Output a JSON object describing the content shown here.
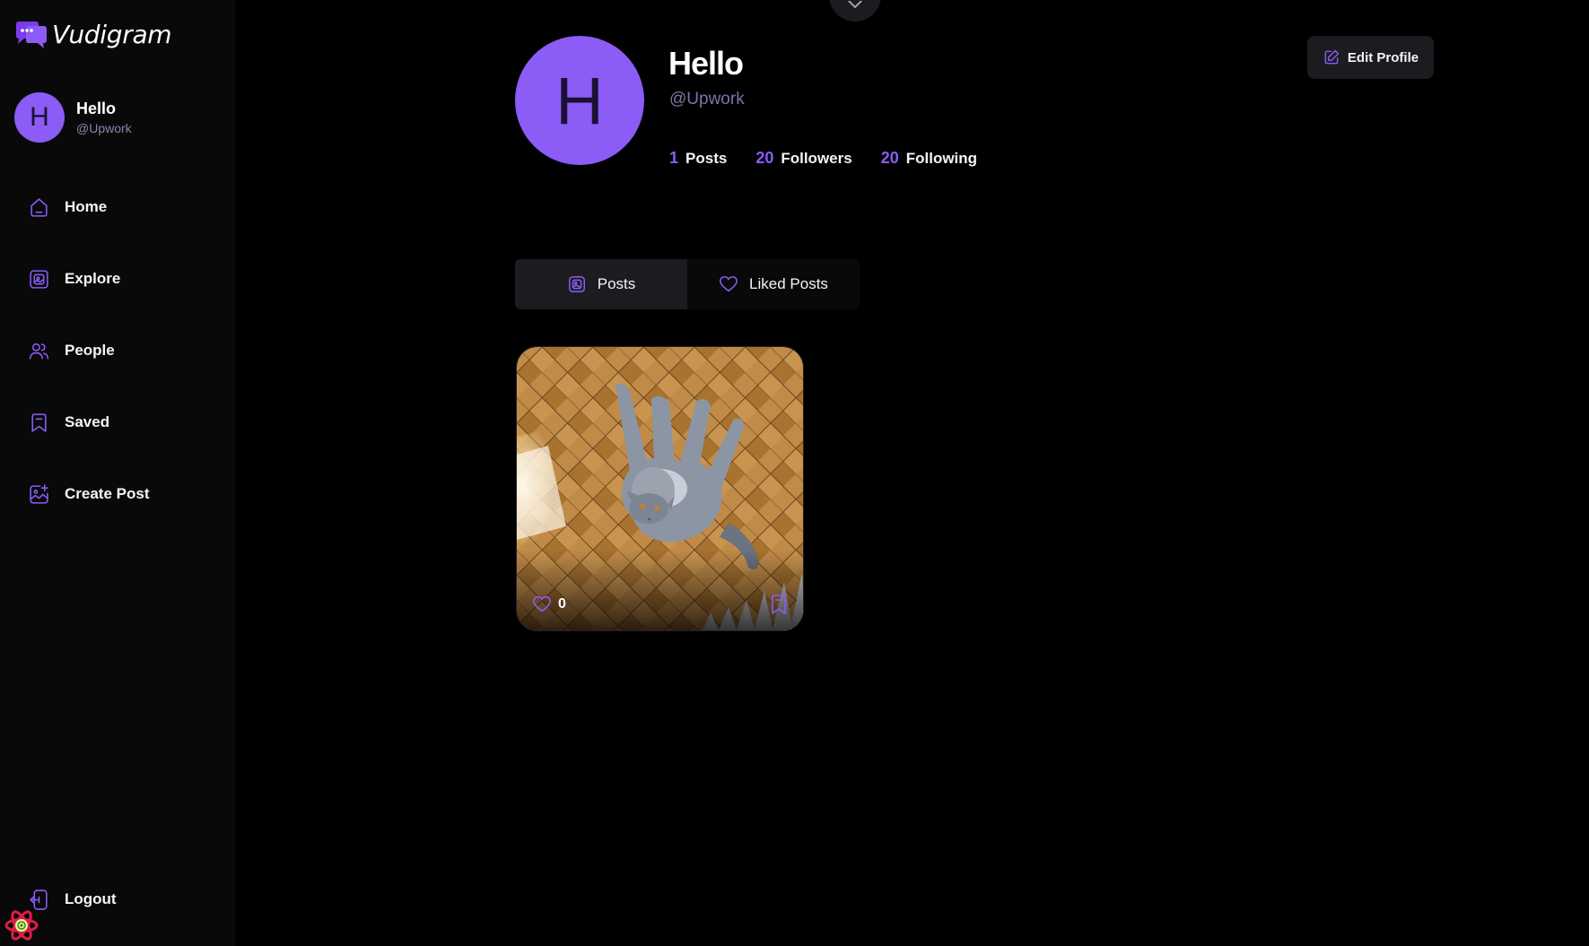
{
  "app": {
    "name": "Vudigram"
  },
  "colors": {
    "accent": "#8b5cf6",
    "sidebar_bg": "#09090a",
    "page_bg": "#000000",
    "card_bg": "#1c1c20"
  },
  "user": {
    "initial": "H",
    "name": "Hello",
    "handle": "@Upwork"
  },
  "nav": [
    {
      "label": "Home",
      "icon": "home-icon"
    },
    {
      "label": "Explore",
      "icon": "explore-icon"
    },
    {
      "label": "People",
      "icon": "people-icon"
    },
    {
      "label": "Saved",
      "icon": "bookmark-icon"
    },
    {
      "label": "Create Post",
      "icon": "create-post-icon"
    }
  ],
  "logout": {
    "label": "Logout",
    "icon": "logout-icon"
  },
  "profile": {
    "stats": [
      {
        "value": "1",
        "label": "Posts"
      },
      {
        "value": "20",
        "label": "Followers"
      },
      {
        "value": "20",
        "label": "Following"
      }
    ],
    "edit_label": "Edit Profile"
  },
  "tabs": [
    {
      "label": "Posts",
      "icon": "posts-icon",
      "active": true
    },
    {
      "label": "Liked Posts",
      "icon": "heart-icon",
      "active": false
    }
  ],
  "posts": [
    {
      "image": "grey cat lying on parquet floor",
      "likes": "0"
    }
  ]
}
